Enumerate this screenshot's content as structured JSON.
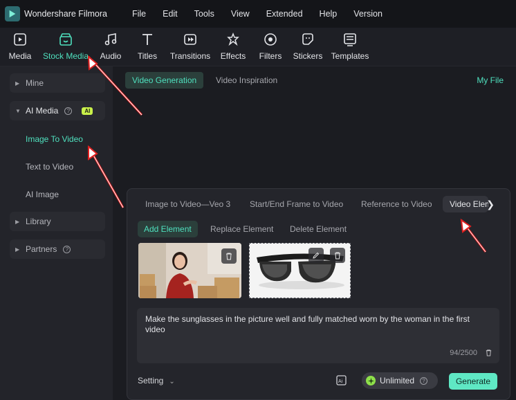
{
  "app": {
    "name": "Wondershare Filmora"
  },
  "menu": [
    "File",
    "Edit",
    "Tools",
    "View",
    "Extended",
    "Help",
    "Version"
  ],
  "toolbar": [
    {
      "label": "Media",
      "icon": "media-icon"
    },
    {
      "label": "Stock Media",
      "icon": "stock-media-icon",
      "active": true
    },
    {
      "label": "Audio",
      "icon": "audio-icon"
    },
    {
      "label": "Titles",
      "icon": "titles-icon"
    },
    {
      "label": "Transitions",
      "icon": "transitions-icon"
    },
    {
      "label": "Effects",
      "icon": "effects-icon"
    },
    {
      "label": "Filters",
      "icon": "filters-icon"
    },
    {
      "label": "Stickers",
      "icon": "stickers-icon"
    },
    {
      "label": "Templates",
      "icon": "templates-icon"
    }
  ],
  "sidebar": {
    "mine": "Mine",
    "ai_media": "AI Media",
    "ai_badge": "AI",
    "image_to_video": "Image To Video",
    "text_to_video": "Text to Video",
    "ai_image": "AI Image",
    "library": "Library",
    "partners": "Partners"
  },
  "main": {
    "tab_video_generation": "Video Generation",
    "tab_video_inspiration": "Video Inspiration",
    "my_file": "My File"
  },
  "panel": {
    "tabs": [
      "Image to Video—Veo 3",
      "Start/End Frame to Video",
      "Reference to Video",
      "Video Element"
    ],
    "subtabs": [
      "Add Element",
      "Replace Element",
      "Delete Element"
    ],
    "prompt_text": "Make the sunglasses in the picture well and fully matched worn by the woman in the first video",
    "char_count": "94/2500",
    "setting_label": "Setting",
    "unlimited_label": "Unlimited",
    "generate_label": "Generate"
  },
  "colors": {
    "accent": "#4fe0be",
    "generate": "#5fe8c4",
    "annotation": "#e02020"
  }
}
